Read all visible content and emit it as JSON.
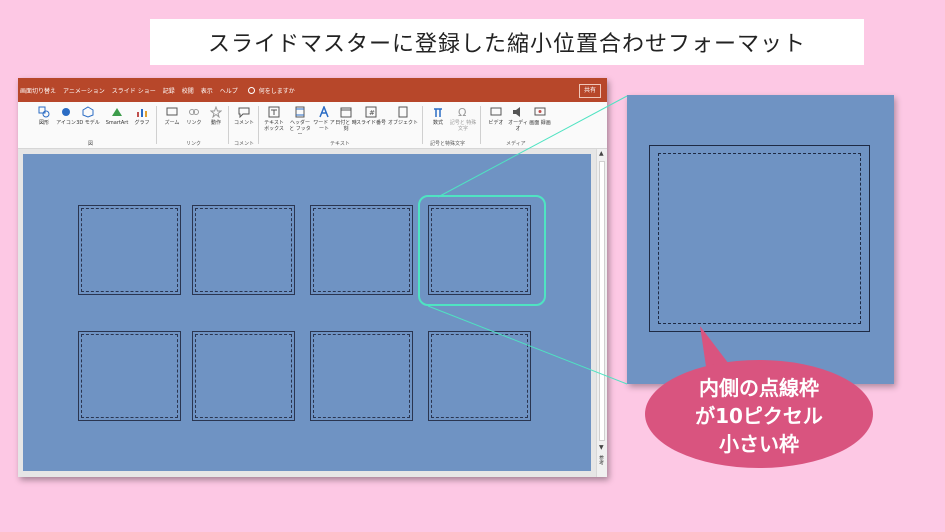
{
  "title": "スライドマスターに登録した縮小位置合わせフォーマット",
  "app": {
    "tabs": [
      "画面切り替え",
      "アニメーション",
      "スライド ショー",
      "記録",
      "校閲",
      "表示",
      "ヘルプ"
    ],
    "tell_me": "何をしますか",
    "share": "共有",
    "ribbon": {
      "buttons": [
        {
          "label": "図形",
          "icon": "shapes-icon"
        },
        {
          "label": "アイコン",
          "icon": "icons-icon"
        },
        {
          "label": "3D モデル",
          "icon": "3d-model-icon"
        },
        {
          "label": "SmartArt",
          "icon": "smartart-icon"
        },
        {
          "label": "グラフ",
          "icon": "chart-icon"
        },
        {
          "label": "ズーム",
          "icon": "zoom-icon"
        },
        {
          "label": "リンク",
          "icon": "link-icon"
        },
        {
          "label": "動作",
          "icon": "action-icon"
        },
        {
          "label": "コメント",
          "icon": "comment-icon"
        },
        {
          "label": "テキスト ボックス",
          "icon": "textbox-icon"
        },
        {
          "label": "ヘッダーと フッター",
          "icon": "header-footer-icon"
        },
        {
          "label": "ワード アート",
          "icon": "wordart-icon"
        },
        {
          "label": "日付と 時刻",
          "icon": "datetime-icon"
        },
        {
          "label": "スライド番号",
          "icon": "slide-number-icon"
        },
        {
          "label": "オブジェクト",
          "icon": "object-icon"
        },
        {
          "label": "数式",
          "icon": "pi-icon"
        },
        {
          "label": "記号と 特殊文字",
          "icon": "omega-icon"
        },
        {
          "label": "ビデオ",
          "icon": "video-icon"
        },
        {
          "label": "オーディオ",
          "icon": "audio-icon"
        },
        {
          "label": "画面 録画",
          "icon": "screen-record-icon"
        }
      ],
      "groups": [
        "図",
        "リンク",
        "コメント",
        "テキスト",
        "記号と特殊文字",
        "メディア"
      ]
    },
    "side_label": "参考"
  },
  "callout": {
    "lines": [
      "内側の点線枠",
      "が10ピクセル",
      "小さい枠"
    ],
    "color": "#d9547f"
  },
  "colors": {
    "background": "#fdc8e4",
    "ribbon_tab": "#b7472a",
    "slide": "#6f93c3",
    "highlight": "#4fe3c2"
  }
}
